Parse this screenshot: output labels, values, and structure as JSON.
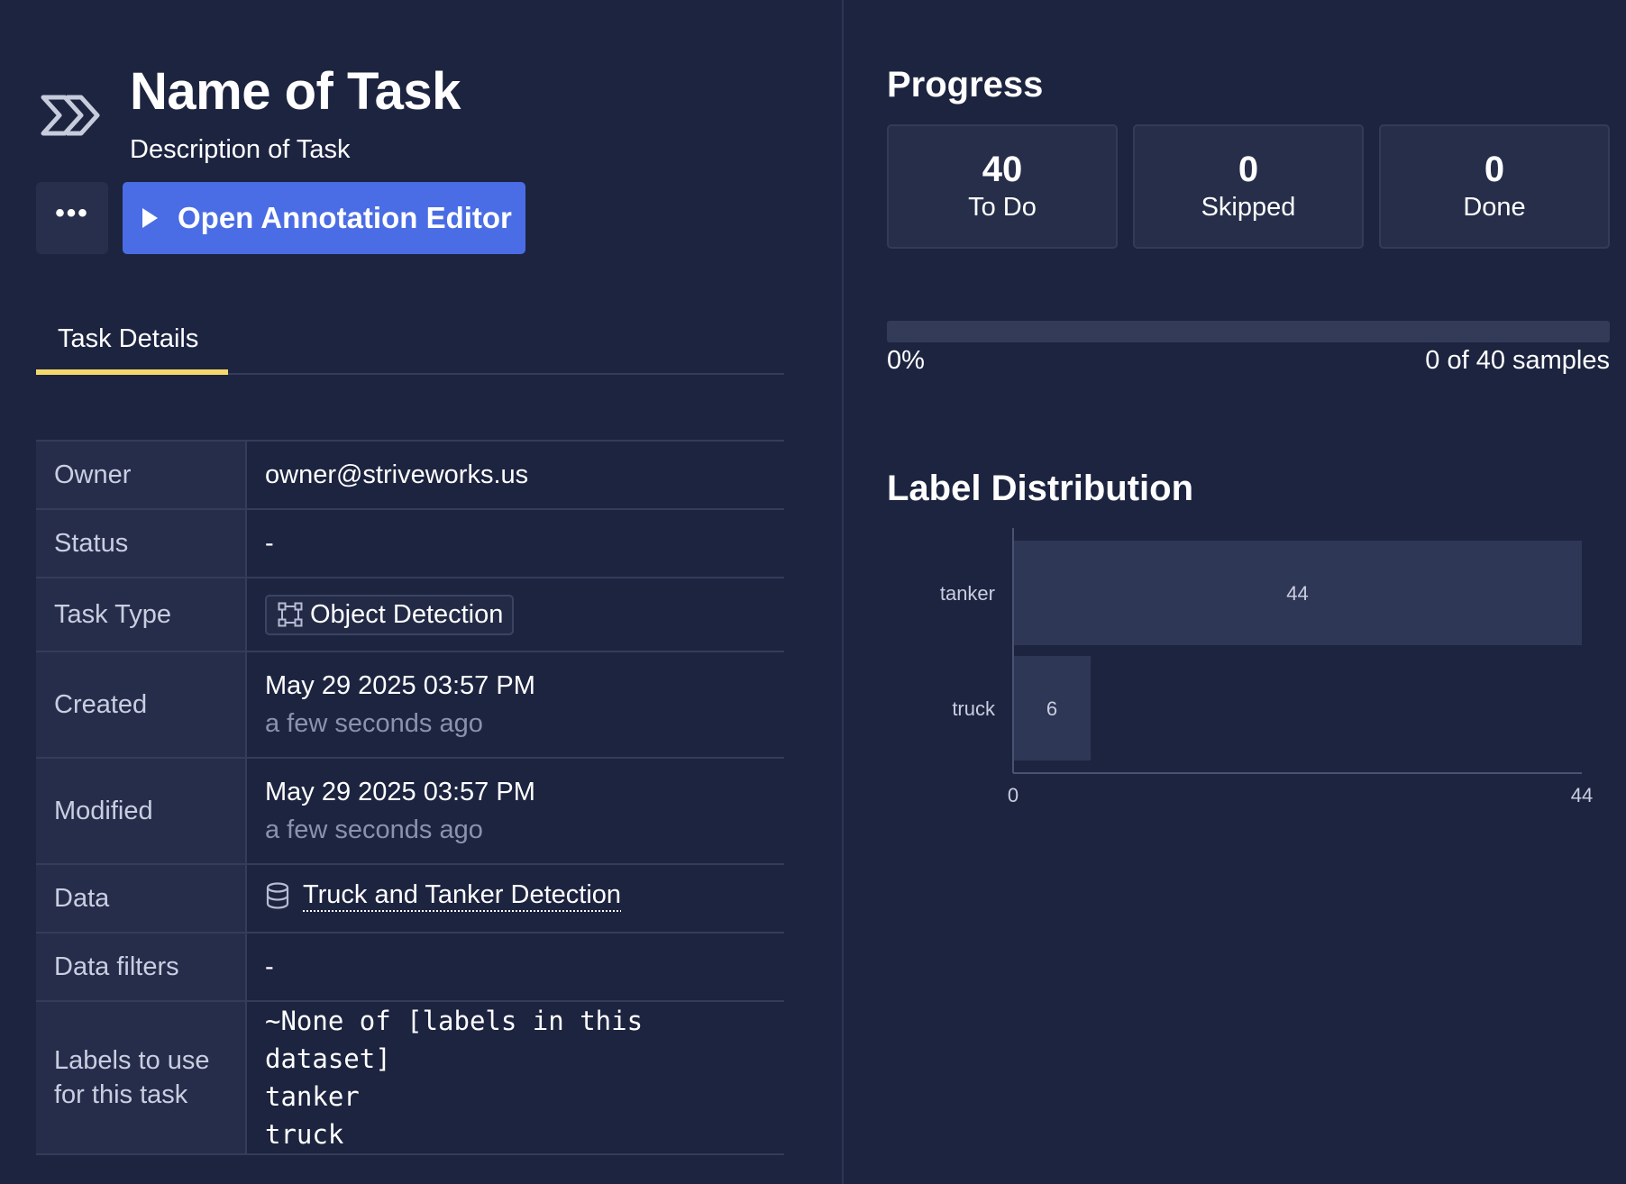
{
  "task": {
    "title": "Name of Task",
    "description": "Description of Task",
    "icon": "chevrons-right-icon"
  },
  "actions": {
    "more_label": "•••",
    "open_editor_label": "Open Annotation Editor"
  },
  "tabs": [
    {
      "label": "Task Details",
      "active": true
    }
  ],
  "details": {
    "owner": {
      "key": "Owner",
      "value": "owner@striveworks.us"
    },
    "status": {
      "key": "Status",
      "value": "-"
    },
    "task_type": {
      "key": "Task Type",
      "value": "Object Detection",
      "icon": "bounding-box-icon"
    },
    "created": {
      "key": "Created",
      "value": "May 29 2025 03:57 PM",
      "relative": "a few seconds ago"
    },
    "modified": {
      "key": "Modified",
      "value": "May 29 2025 03:57 PM",
      "relative": "a few seconds ago"
    },
    "data": {
      "key": "Data",
      "value": "Truck and Tanker Detection",
      "icon": "database-icon"
    },
    "data_filters": {
      "key": "Data filters",
      "value": "-"
    },
    "labels": {
      "key": "Labels to use for this task",
      "lines": [
        "~None of [labels in this dataset]",
        "tanker",
        "truck"
      ]
    }
  },
  "progress": {
    "title": "Progress",
    "stats": [
      {
        "value": "40",
        "label": "To Do"
      },
      {
        "value": "0",
        "label": "Skipped"
      },
      {
        "value": "0",
        "label": "Done"
      }
    ],
    "fraction": 0,
    "percent_label": "0%",
    "samples_label": "0 of 40 samples"
  },
  "label_distribution": {
    "title": "Label Distribution"
  },
  "chart_data": {
    "type": "bar",
    "orientation": "horizontal",
    "categories": [
      "tanker",
      "truck"
    ],
    "values": [
      44,
      6
    ],
    "xlim": [
      0,
      44
    ],
    "x_ticks": [
      "0",
      "44"
    ],
    "grid": false,
    "bar_color": "#2f3756"
  },
  "colors": {
    "background": "#1d2440",
    "accent": "#4a6de5",
    "tab_underline": "#f4d86b"
  }
}
